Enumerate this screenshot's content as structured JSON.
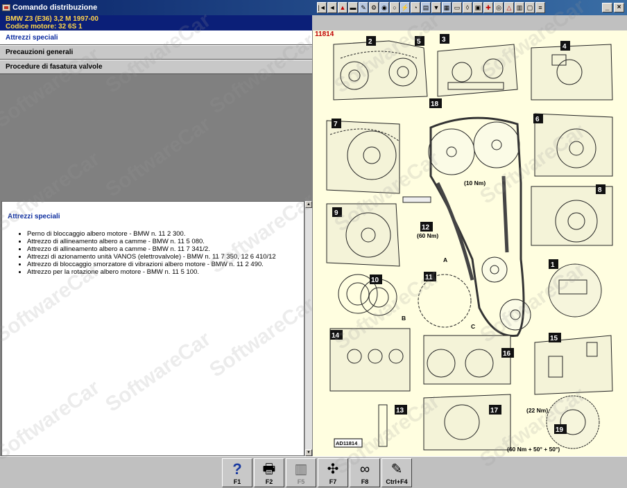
{
  "window": {
    "title": "Comando distribuzione"
  },
  "vehicle": {
    "line1": "BMW   Z3 (E36) 3,2 M 1997-00",
    "line2": "Codice motore: 32 6S 1"
  },
  "toolbar": {
    "icons": [
      "first-icon",
      "prev-icon",
      "warning-icon",
      "doc-icon",
      "tool-icon",
      "engine-icon",
      "brake-icon",
      "wheel-icon",
      "electric-icon",
      "gauge-icon",
      "book-icon",
      "oil-icon",
      "filter-icon",
      "car-icon",
      "lamp-icon",
      "battery-icon",
      "fuse-icon",
      "timing-icon",
      "alert-icon",
      "diagram-icon",
      "chassis-icon",
      "wiring-icon"
    ]
  },
  "sidebar": {
    "items": [
      {
        "label": "Attrezzi speciali",
        "active": true
      },
      {
        "label": "Precauzioni generali",
        "active": false
      },
      {
        "label": "Procedure di fasatura valvole",
        "active": false
      }
    ]
  },
  "content": {
    "heading": "Attrezzi speciali",
    "items": [
      "Perno di bloccaggio albero motore - BMW n. 11 2 300.",
      "Attrezzo di allineamento albero a camme - BMW n. 11 5 080.",
      "Attrezzo di allineamento albero a camme - BMW n. 11 7 341/2.",
      "Attrezzi di azionamento unità VANOS (elettrovalvole) - BMW n. 11 7 350, 12 6 410/12",
      "Attrezzo di bloccaggio smorzatore di vibrazioni albero motore - BMW n. 11 2 490.",
      "Attrezzo per la rotazione albero motore - BMW n. 11 5 100."
    ]
  },
  "diagram": {
    "doc_number": "11814",
    "doc_code": "AD11814",
    "callouts": [
      "1",
      "2",
      "3",
      "4",
      "5",
      "6",
      "7",
      "8",
      "9",
      "10",
      "11",
      "12",
      "13",
      "14",
      "15",
      "16",
      "17",
      "18",
      "19"
    ],
    "torque_10": "(10 Nm)",
    "torque_60": "(60 Nm)",
    "torque_22": "(22 Nm)",
    "torque_final": "(60 Nm + 50° + 50°)",
    "letters": [
      "A",
      "B",
      "C"
    ]
  },
  "functions": [
    {
      "label": "F1",
      "icon": "help-icon",
      "enabled": true
    },
    {
      "label": "F2",
      "icon": "print-icon",
      "enabled": true
    },
    {
      "label": "F5",
      "icon": "book-icon",
      "enabled": false
    },
    {
      "label": "F7",
      "icon": "tool-icon",
      "enabled": true
    },
    {
      "label": "F8",
      "icon": "timing-belt-icon",
      "enabled": true
    },
    {
      "label": "Ctrl+F4",
      "icon": "notes-icon",
      "enabled": true
    }
  ],
  "watermark": "SoftwareCar"
}
